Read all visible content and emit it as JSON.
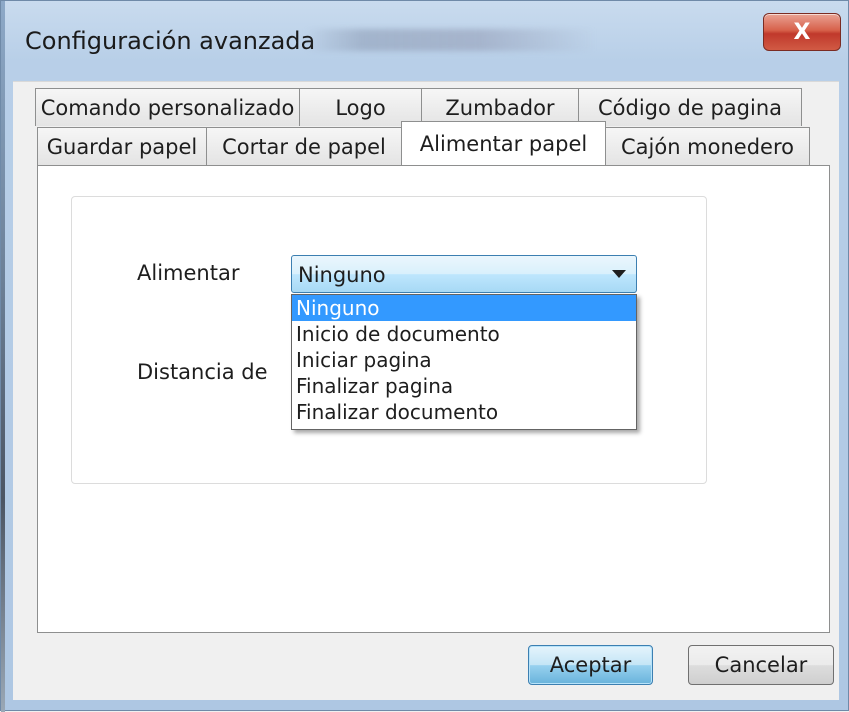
{
  "window": {
    "title": "Configuración avanzada",
    "close_glyph": "X"
  },
  "tabs_row1": [
    {
      "label": "Comando personalizado"
    },
    {
      "label": "Logo"
    },
    {
      "label": "Zumbador"
    },
    {
      "label": "Código de pagina"
    }
  ],
  "tabs_row2": [
    {
      "label": "Guardar papel"
    },
    {
      "label": "Cortar de papel"
    },
    {
      "label": "Alimentar papel",
      "active": true
    },
    {
      "label": "Cajón monedero"
    }
  ],
  "form": {
    "feed_label": "Alimentar",
    "distance_label": "Distancia de",
    "feed_combo": {
      "selected": "Ninguno",
      "options": [
        "Ninguno",
        "Inicio de documento",
        "Iniciar pagina",
        "Finalizar pagina",
        "Finalizar documento"
      ]
    }
  },
  "buttons": {
    "ok": "Aceptar",
    "cancel": "Cancelar"
  },
  "colors": {
    "selection": "#3399ff",
    "close_button": "#c0392b"
  }
}
